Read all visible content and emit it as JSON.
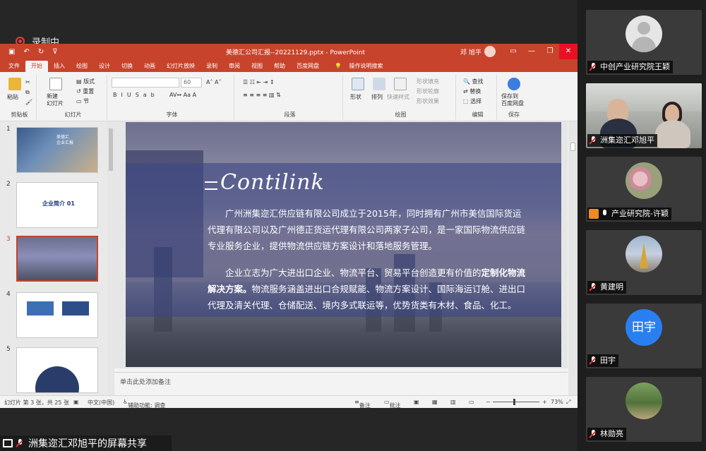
{
  "recording": {
    "label": "录制中"
  },
  "ppt": {
    "doc_title": "美德汇公司汇报--20221129.pptx - PowerPoint",
    "user_name": "邓 旭平",
    "menu_tabs": [
      "文件",
      "开始",
      "插入",
      "绘图",
      "设计",
      "切换",
      "动画",
      "幻灯片放映",
      "录制",
      "审阅",
      "视图",
      "帮助",
      "百度网盘"
    ],
    "active_tab": "开始",
    "search_label": "操作说明搜索",
    "ribbon": {
      "paste": "粘贴",
      "clipboard": "剪贴板",
      "new_slide": "新建\n幻灯片",
      "layout": "版式",
      "reset": "重置",
      "section": "节",
      "slides": "幻灯片",
      "font_size": "60",
      "font": "字体",
      "paragraph": "段落",
      "shape": "形状",
      "arrange": "排列",
      "quick_style": "快速样式",
      "shape_fill": "形状填充",
      "shape_outline": "形状轮廓",
      "shape_effect": "形状效果",
      "drawing": "绘图",
      "find": "查找",
      "replace": "替换",
      "select": "选择",
      "editing": "编辑",
      "save_to_baidu": "保存到\n百度网盘",
      "save": "保存"
    },
    "thumbnails": [
      {
        "num": "1",
        "caption": "美德汇\n企业汇报"
      },
      {
        "num": "2",
        "caption": "企业简介 01"
      },
      {
        "num": "3",
        "caption": ""
      },
      {
        "num": "4",
        "caption": ""
      },
      {
        "num": "5",
        "caption": ""
      }
    ],
    "slide": {
      "logo": "Contilink",
      "para1": "广州洲集迩汇供应链有限公司成立于2015年，同时拥有广州市美信国际货运代理有限公司以及广州德正货运代理有限公司两家子公司，是一家国际物流供应链专业服务企业，提供物流供应链方案设计和落地服务管理。",
      "para2_a": "企业立志为广大进出口企业、物流平台、贸易平台创造更有价值的",
      "para2_b": "定制化物流解决方案。",
      "para2_c": "物流服务涵盖进出口合规赋能、物流方案设计、国际海运订舱、进出口代理及清关代理、仓储配送、境内多式联运等，优势货类有木材、食品、化工。"
    },
    "notes_placeholder": "单击此处添加备注",
    "status": {
      "slide_pos": "幻灯片 第 3 张，共 25 张",
      "lang": "中文(中国)",
      "accessibility": "辅助功能: 调查",
      "notes": "备注",
      "comments": "批注",
      "zoom": "73%"
    }
  },
  "participants": [
    {
      "name": "中创产业研究院王颖",
      "avatar": "default"
    },
    {
      "name": "洲集迩汇邓旭平",
      "avatar": "video"
    },
    {
      "name": "产业研究院-许颖",
      "avatar": "flower"
    },
    {
      "name": "黄建明",
      "avatar": "pagoda"
    },
    {
      "name": "田宇",
      "avatar": "text",
      "initials": "田宇"
    },
    {
      "name": "林勋亮",
      "avatar": "tree"
    }
  ],
  "share_label": "洲集迩汇邓旭平的屏幕共享",
  "colors": {
    "ppt_accent": "#c8432b",
    "mute_red": "#e53030",
    "avatar_blue": "#2a7ff0"
  }
}
